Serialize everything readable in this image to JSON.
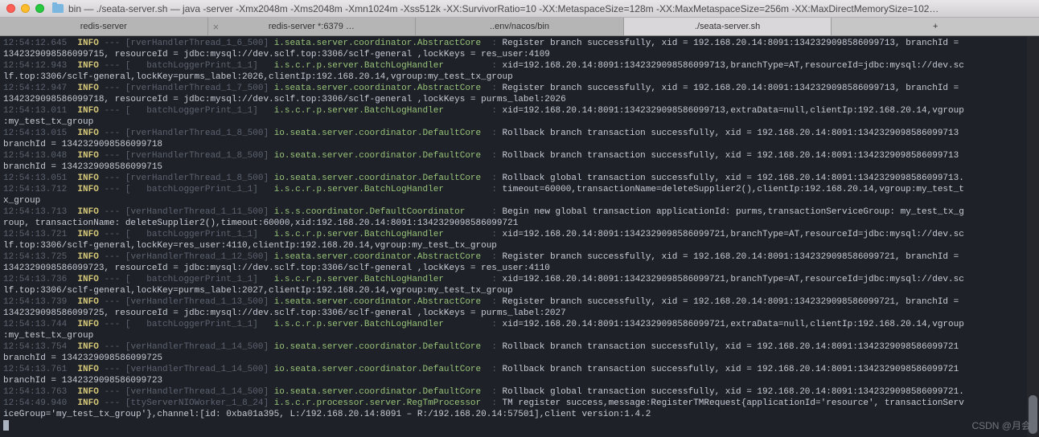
{
  "window": {
    "title": "bin — ./seata-server.sh — java -server -Xmx2048m -Xms2048m -Xmn1024m -Xss512k -XX:SurvivorRatio=10 -XX:MetaspaceSize=128m -XX:MaxMetaspaceSize=256m -XX:MaxDirectMemorySize=102…"
  },
  "tabs": {
    "t0": "redis-server",
    "t1": "redis-server *:6379 …",
    "t2": "..env/nacos/bin",
    "t3": "./seata-server.sh",
    "add": "+"
  },
  "watermark": "CSDN @月会",
  "log": [
    {
      "ts": "12:54:12.645",
      "lvl": "INFO",
      "thread": "[rverHandlerThread_1_6_500]",
      "logger": "i.seata.server.coordinator.AbstractCore",
      "msg": "Register branch successfully, xid = 192.168.20.14:8091:1342329098586099713, branchId ="
    },
    {
      "cont": "1342329098586099715, resourceId = jdbc:mysql://dev.sclf.top:3306/sclf-general ,lockKeys = res_user:4109"
    },
    {
      "ts": "12:54:12.943",
      "lvl": "INFO",
      "thread": "[   batchLoggerPrint_1_1]",
      "logger": "i.s.c.r.p.server.BatchLogHandler",
      "msg": "xid=192.168.20.14:8091:1342329098586099713,branchType=AT,resourceId=jdbc:mysql://dev.sc"
    },
    {
      "cont": "lf.top:3306/sclf-general,lockKey=purms_label:2026,clientIp:192.168.20.14,vgroup:my_test_tx_group"
    },
    {
      "ts": "12:54:12.947",
      "lvl": "INFO",
      "thread": "[rverHandlerThread_1_7_500]",
      "logger": "i.seata.server.coordinator.AbstractCore",
      "msg": "Register branch successfully, xid = 192.168.20.14:8091:1342329098586099713, branchId ="
    },
    {
      "cont": "1342329098586099718, resourceId = jdbc:mysql://dev.sclf.top:3306/sclf-general ,lockKeys = purms_label:2026"
    },
    {
      "ts": "12:54:13.011",
      "lvl": "INFO",
      "thread": "[   batchLoggerPrint_1_1]",
      "logger": "i.s.c.r.p.server.BatchLogHandler",
      "msg": "xid=192.168.20.14:8091:1342329098586099713,extraData=null,clientIp:192.168.20.14,vgroup"
    },
    {
      "cont": ":my_test_tx_group"
    },
    {
      "ts": "12:54:13.015",
      "lvl": "INFO",
      "thread": "[rverHandlerThread_1_8_500]",
      "logger": "io.seata.server.coordinator.DefaultCore",
      "msg": "Rollback branch transaction successfully, xid = 192.168.20.14:8091:1342329098586099713"
    },
    {
      "cont": "branchId = 1342329098586099718"
    },
    {
      "ts": "12:54:13.048",
      "lvl": "INFO",
      "thread": "[rverHandlerThread_1_8_500]",
      "logger": "io.seata.server.coordinator.DefaultCore",
      "msg": "Rollback branch transaction successfully, xid = 192.168.20.14:8091:1342329098586099713"
    },
    {
      "cont": "branchId = 1342329098586099715"
    },
    {
      "ts": "12:54:13.051",
      "lvl": "INFO",
      "thread": "[rverHandlerThread_1_8_500]",
      "logger": "io.seata.server.coordinator.DefaultCore",
      "msg": "Rollback global transaction successfully, xid = 192.168.20.14:8091:1342329098586099713."
    },
    {
      "ts": "12:54:13.712",
      "lvl": "INFO",
      "thread": "[   batchLoggerPrint_1_1]",
      "logger": "i.s.c.r.p.server.BatchLogHandler",
      "msg": "timeout=60000,transactionName=deleteSupplier2(),clientIp:192.168.20.14,vgroup:my_test_t"
    },
    {
      "cont": "x_group"
    },
    {
      "ts": "12:54:13.713",
      "lvl": "INFO",
      "thread": "[verHandlerThread_1_11_500]",
      "logger": "i.s.s.coordinator.DefaultCoordinator",
      "msg": "Begin new global transaction applicationId: purms,transactionServiceGroup: my_test_tx_g"
    },
    {
      "cont": "roup, transactionName: deleteSupplier2(),timeout:60000,xid:192.168.20.14:8091:1342329098586099721"
    },
    {
      "ts": "12:54:13.721",
      "lvl": "INFO",
      "thread": "[   batchLoggerPrint_1_1]",
      "logger": "i.s.c.r.p.server.BatchLogHandler",
      "msg": "xid=192.168.20.14:8091:1342329098586099721,branchType=AT,resourceId=jdbc:mysql://dev.sc"
    },
    {
      "cont": "lf.top:3306/sclf-general,lockKey=res_user:4110,clientIp:192.168.20.14,vgroup:my_test_tx_group"
    },
    {
      "ts": "12:54:13.725",
      "lvl": "INFO",
      "thread": "[verHandlerThread_1_12_500]",
      "logger": "i.seata.server.coordinator.AbstractCore",
      "msg": "Register branch successfully, xid = 192.168.20.14:8091:1342329098586099721, branchId ="
    },
    {
      "cont": "1342329098586099723, resourceId = jdbc:mysql://dev.sclf.top:3306/sclf-general ,lockKeys = res_user:4110"
    },
    {
      "ts": "12:54:13.736",
      "lvl": "INFO",
      "thread": "[   batchLoggerPrint_1_1]",
      "logger": "i.s.c.r.p.server.BatchLogHandler",
      "msg": "xid=192.168.20.14:8091:1342329098586099721,branchType=AT,resourceId=jdbc:mysql://dev.sc"
    },
    {
      "cont": "lf.top:3306/sclf-general,lockKey=purms_label:2027,clientIp:192.168.20.14,vgroup:my_test_tx_group"
    },
    {
      "ts": "12:54:13.739",
      "lvl": "INFO",
      "thread": "[verHandlerThread_1_13_500]",
      "logger": "i.seata.server.coordinator.AbstractCore",
      "msg": "Register branch successfully, xid = 192.168.20.14:8091:1342329098586099721, branchId ="
    },
    {
      "cont": "1342329098586099725, resourceId = jdbc:mysql://dev.sclf.top:3306/sclf-general ,lockKeys = purms_label:2027"
    },
    {
      "ts": "12:54:13.744",
      "lvl": "INFO",
      "thread": "[   batchLoggerPrint_1_1]",
      "logger": "i.s.c.r.p.server.BatchLogHandler",
      "msg": "xid=192.168.20.14:8091:1342329098586099721,extraData=null,clientIp:192.168.20.14,vgroup"
    },
    {
      "cont": ":my_test_tx_group"
    },
    {
      "ts": "12:54:13.754",
      "lvl": "INFO",
      "thread": "[verHandlerThread_1_14_500]",
      "logger": "io.seata.server.coordinator.DefaultCore",
      "msg": "Rollback branch transaction successfully, xid = 192.168.20.14:8091:1342329098586099721"
    },
    {
      "cont": "branchId = 1342329098586099725"
    },
    {
      "ts": "12:54:13.761",
      "lvl": "INFO",
      "thread": "[verHandlerThread_1_14_500]",
      "logger": "io.seata.server.coordinator.DefaultCore",
      "msg": "Rollback branch transaction successfully, xid = 192.168.20.14:8091:1342329098586099721"
    },
    {
      "cont": "branchId = 1342329098586099723"
    },
    {
      "ts": "12:54:13.763",
      "lvl": "INFO",
      "thread": "[verHandlerThread_1_14_500]",
      "logger": "io.seata.server.coordinator.DefaultCore",
      "msg": "Rollback global transaction successfully, xid = 192.168.20.14:8091:1342329098586099721."
    },
    {
      "ts": "12:54:49.940",
      "lvl": "INFO",
      "thread": "[ttyServerNIOWorker_1_8_24]",
      "logger": "i.s.c.r.processor.server.RegTmProcessor",
      "msg": "TM register success,message:RegisterTMRequest{applicationId='resource', transactionServ"
    },
    {
      "cont": "iceGroup='my_test_tx_group'},channel:[id: 0xba01a395, L:/192.168.20.14:8091 – R:/192.168.20.14:57501],client version:1.4.2"
    }
  ]
}
